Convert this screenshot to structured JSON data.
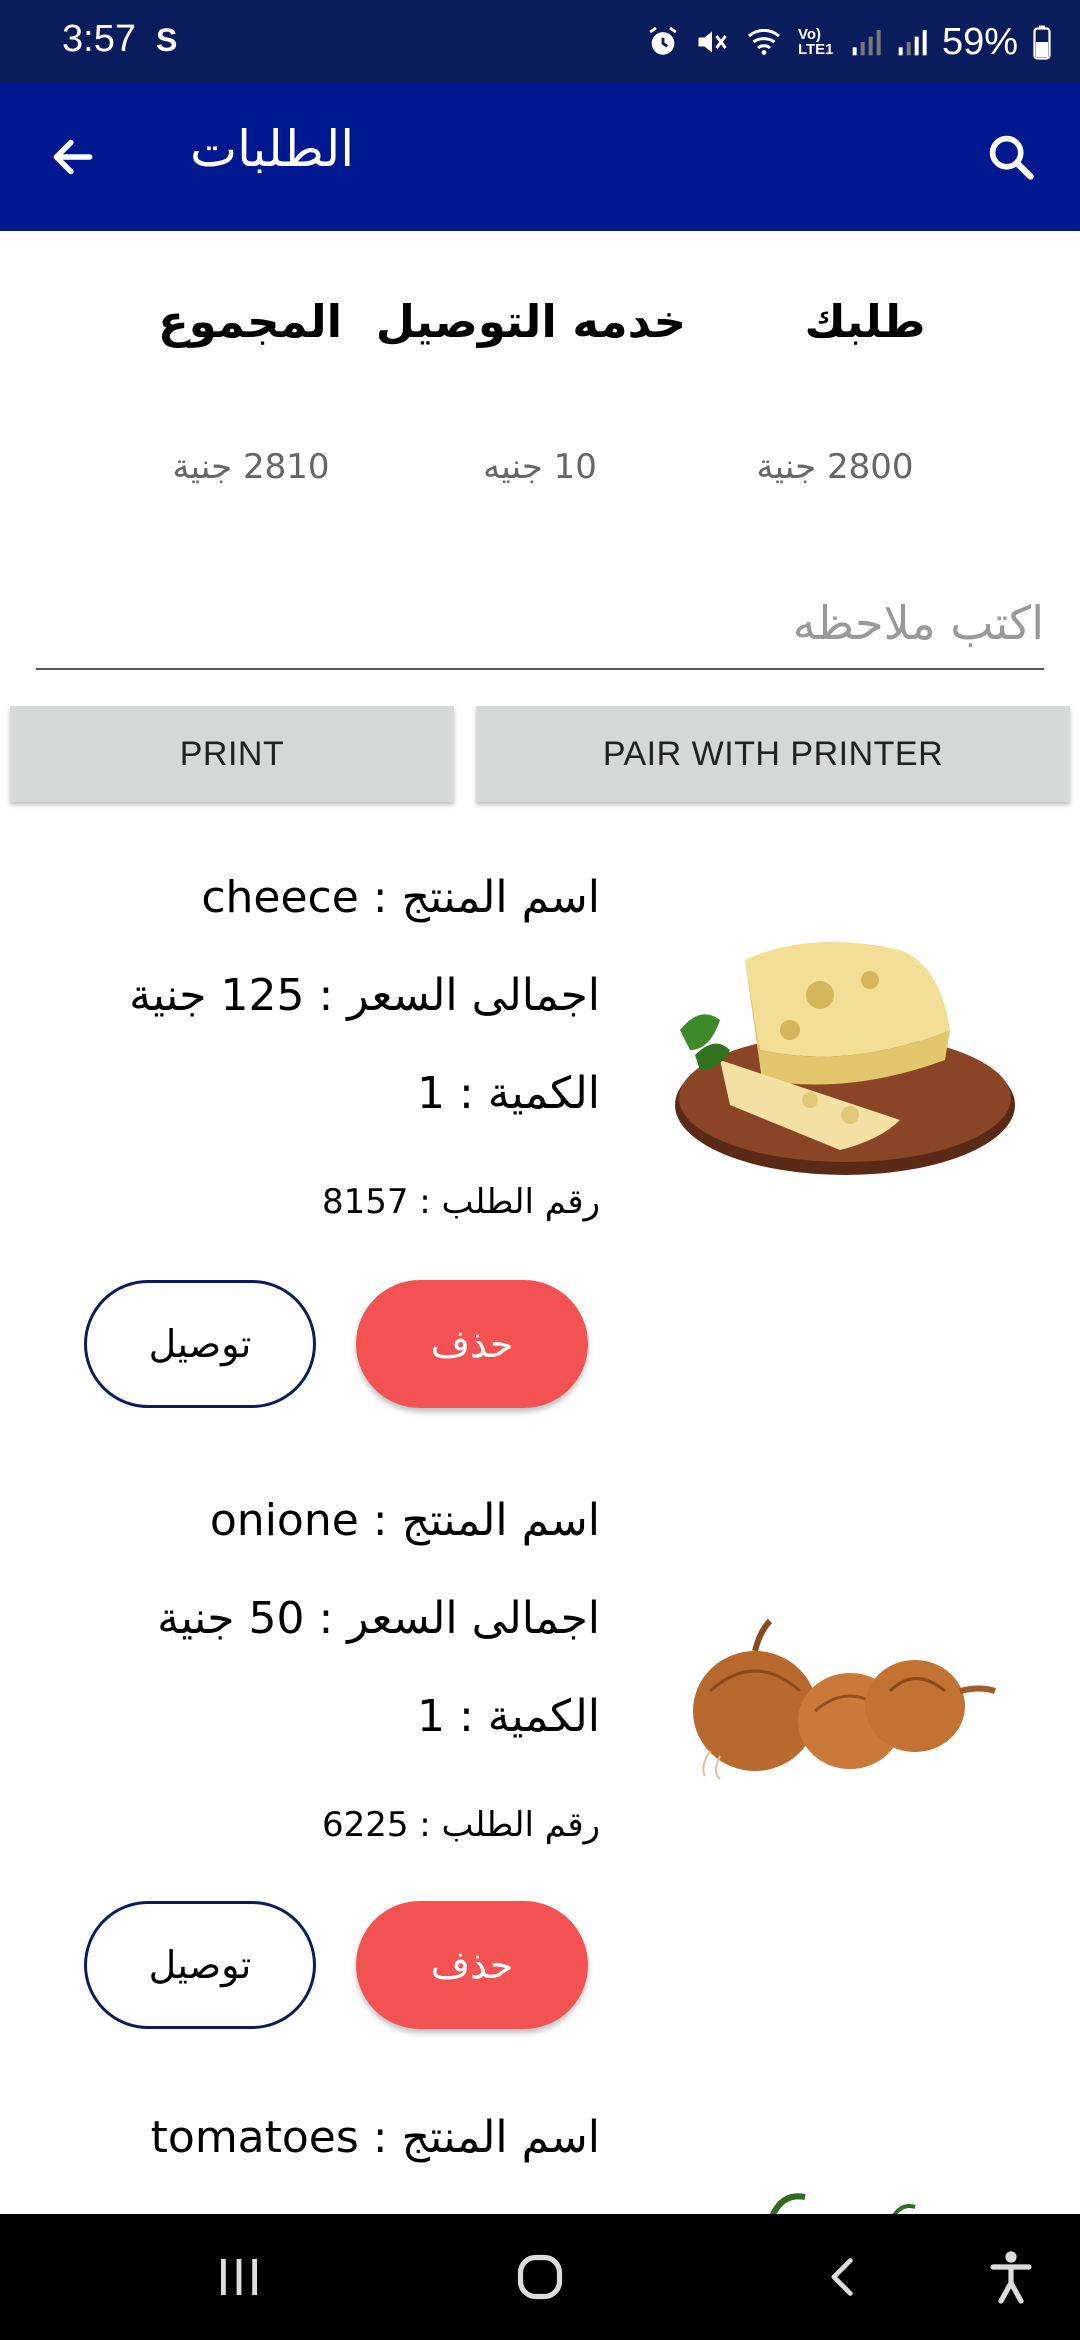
{
  "status_bar": {
    "time": "3:57",
    "sync_glyph": "S",
    "battery": "59%",
    "icons": [
      "alarm-icon",
      "mute-icon",
      "wifi-icon",
      "volte-icon",
      "signal-icon",
      "signal-icon",
      "battery-icon"
    ],
    "volte_label": "Vo) LTE1"
  },
  "app_bar": {
    "title": "الطلبات",
    "background": "#00188f"
  },
  "summary": {
    "order_label": "طلبك",
    "delivery_label": "خدمه التوصيل",
    "total_label": "المجموع",
    "order_value": "2800 جنية",
    "delivery_value": "10 جنيه",
    "total_value": "2810 جنية"
  },
  "note": {
    "placeholder": "اكتب ملاحظه"
  },
  "buttons": {
    "print": "PRINT",
    "pair": "PAIR WITH PRINTER"
  },
  "items": [
    {
      "name_line": "اسم المنتج : cheece",
      "price_line": "اجمالى السعر : 125 جنية",
      "qty_line": "الكمية : 1",
      "order_no_line": "رقم الطلب : 8157",
      "delete_label": "حذف",
      "deliver_label": "توصيل",
      "image": "cheese-image"
    },
    {
      "name_line": "اسم المنتج : onione",
      "price_line": "اجمالى السعر : 50 جنية",
      "qty_line": "الكمية : 1",
      "order_no_line": "رقم الطلب : 6225",
      "delete_label": "حذف",
      "deliver_label": "توصيل",
      "image": "onion-image"
    },
    {
      "name_line": "اسم المنتج : tomatoes",
      "image": "tomato-image"
    }
  ],
  "colors": {
    "status_bar": "#0a1c5c",
    "delete": "#f25252",
    "deliver_border": "#0a1c5c"
  }
}
